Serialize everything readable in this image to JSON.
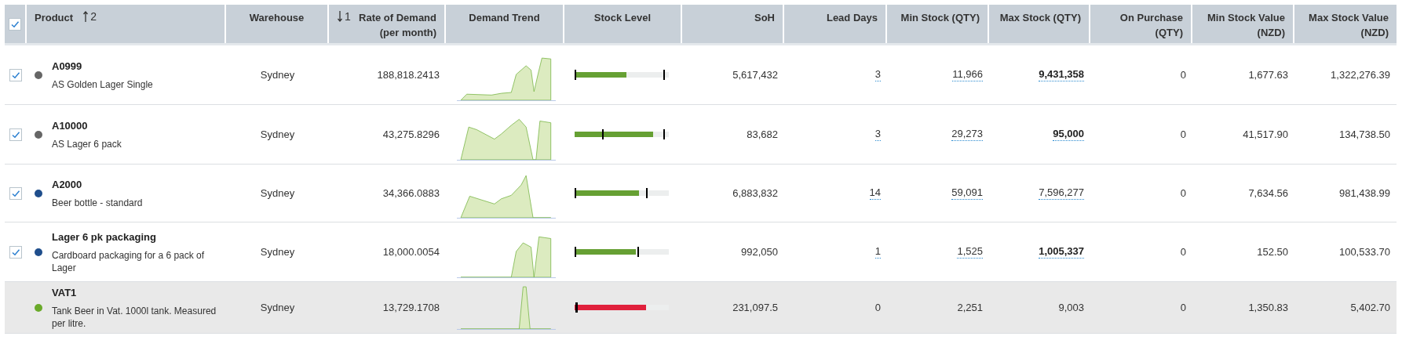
{
  "header": {
    "select_all": {
      "checked": true
    },
    "columns": [
      {
        "label": "Product",
        "sort": {
          "kind": "ascending",
          "order": "2"
        }
      },
      {
        "label": "Warehouse"
      },
      {
        "label": "Rate of Demand (per month)",
        "sort": {
          "kind": "descending",
          "order": "1"
        }
      },
      {
        "label": "Demand Trend"
      },
      {
        "label": "Stock Level"
      },
      {
        "label": "SoH"
      },
      {
        "label": "Lead Days"
      },
      {
        "label": "Min Stock (QTY)"
      },
      {
        "label": "Max Stock (QTY)"
      },
      {
        "label": "On Purchase (QTY)"
      },
      {
        "label": "Min Stock Value (NZD)"
      },
      {
        "label": "Max Stock Value (NZD)"
      }
    ]
  },
  "rows": [
    {
      "selectable": true,
      "selected": true,
      "color": "#666666",
      "code": "A0999",
      "description": "AS Golden Lager Single",
      "warehouse": "Sydney",
      "rate": "188,818.2413",
      "stock_level": {
        "level": 0.55,
        "color": "#66a033",
        "markers": [
          {
            "level": 0
          },
          {
            "level": 0.94
          }
        ]
      },
      "soh": "5,617,432",
      "lead_days": {
        "text": "3",
        "editable": true
      },
      "min_stock": {
        "text": "11,966",
        "editable": true
      },
      "max_stock": {
        "text": "9,431,358",
        "editable": true,
        "bold": true
      },
      "on_purchase": "0",
      "min_value": "1,677.63",
      "max_value": "1,322,276.39"
    },
    {
      "selectable": true,
      "selected": true,
      "color": "#666666",
      "code": "A10000",
      "description": "AS Lager 6 pack",
      "warehouse": "Sydney",
      "rate": "43,275.8296",
      "stock_level": {
        "level": 0.83,
        "color": "#66a033",
        "markers": [
          {
            "level": 0.29
          },
          {
            "level": 0.94
          }
        ]
      },
      "soh": "83,682",
      "lead_days": {
        "text": "3",
        "editable": true
      },
      "min_stock": {
        "text": "29,273",
        "editable": true
      },
      "max_stock": {
        "text": "95,000",
        "editable": true,
        "bold": true
      },
      "on_purchase": "0",
      "min_value": "41,517.90",
      "max_value": "134,738.50"
    },
    {
      "selectable": true,
      "selected": true,
      "color": "#1f4e8c",
      "code": "A2000",
      "description": "Beer bottle - standard",
      "warehouse": "Sydney",
      "rate": "34,366.0883",
      "stock_level": {
        "level": 0.68,
        "color": "#66a033",
        "markers": [
          {
            "level": 0
          },
          {
            "level": 0.76
          }
        ]
      },
      "soh": "6,883,832",
      "lead_days": {
        "text": "14",
        "editable": true
      },
      "min_stock": {
        "text": "59,091",
        "editable": true
      },
      "max_stock": {
        "text": "7,596,277",
        "editable": true,
        "bold": false
      },
      "on_purchase": "0",
      "min_value": "7,634.56",
      "max_value": "981,438.99"
    },
    {
      "selectable": true,
      "selected": true,
      "color": "#1f4e8c",
      "code": "Lager 6 pk packaging",
      "description": "Cardboard packaging for a 6 pack of Lager",
      "warehouse": "Sydney",
      "rate": "18,000.0054",
      "stock_level": {
        "level": 0.65,
        "color": "#66a033",
        "markers": [
          {
            "level": 0
          },
          {
            "level": 0.67
          }
        ]
      },
      "soh": "992,050",
      "lead_days": {
        "text": "1",
        "editable": true
      },
      "min_stock": {
        "text": "1,525",
        "editable": true
      },
      "max_stock": {
        "text": "1,005,337",
        "editable": true,
        "bold": true
      },
      "on_purchase": "0",
      "min_value": "152.50",
      "max_value": "100,533.70"
    },
    {
      "selectable": false,
      "color": "#6aaa2a",
      "code": "VAT1",
      "description": "Tank Beer in Vat. 1000l tank. Measured per litre.",
      "warehouse": "Sydney",
      "rate": "13,729.1708",
      "stock_level": {
        "level": 0.76,
        "color": "#e0203c",
        "markers": [
          {
            "level": 0.005
          },
          {
            "level": 0.02
          }
        ]
      },
      "soh": "231,097.5",
      "lead_days": {
        "text": "0",
        "editable": false
      },
      "min_stock": {
        "text": "2,251",
        "editable": false
      },
      "max_stock": {
        "text": "9,003",
        "editable": false,
        "bold": false
      },
      "on_purchase": "0",
      "min_value": "1,350.83",
      "max_value": "5,402.70"
    }
  ]
}
